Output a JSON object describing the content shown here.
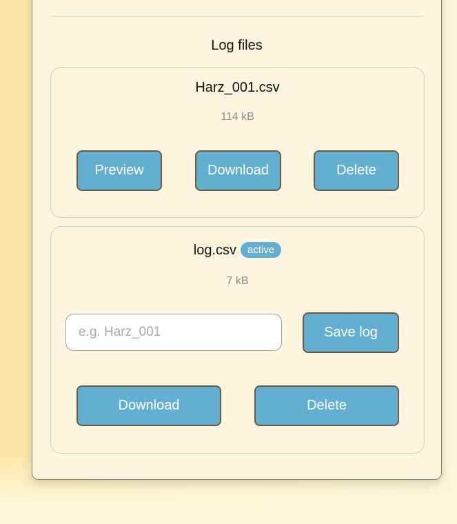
{
  "section": {
    "title": "Log files"
  },
  "files": [
    {
      "name": "Harz_001.csv",
      "size": "114 kB",
      "actions": {
        "preview": "Preview",
        "download": "Download",
        "delete": "Delete"
      }
    },
    {
      "name": "log.csv",
      "badge": "active",
      "size": "7 kB",
      "name_input": {
        "value": "",
        "placeholder": "e.g. Harz_001"
      },
      "actions": {
        "save": "Save log",
        "download": "Download",
        "delete": "Delete"
      }
    }
  ],
  "colors": {
    "button": "#62afd1",
    "button_border": "#6f5a3e",
    "panel": "#fdf5e0"
  }
}
